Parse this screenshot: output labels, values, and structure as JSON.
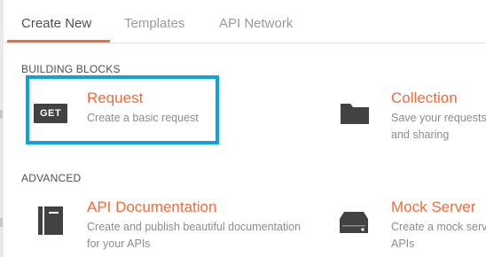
{
  "tabs": [
    {
      "label": "Create New"
    },
    {
      "label": "Templates"
    },
    {
      "label": "API Network"
    }
  ],
  "sections": {
    "building_blocks": "BUILDING BLOCKS",
    "advanced": "ADVANCED"
  },
  "cards": {
    "request": {
      "title": "Request",
      "description": "Create a basic request",
      "icon_text": "GET"
    },
    "collection": {
      "title": "Collection",
      "description_line1": "Save your requests",
      "description_line2": "and sharing"
    },
    "api_documentation": {
      "title": "API Documentation",
      "description_line1": "Create and publish beautiful documentation",
      "description_line2": "for your APIs"
    },
    "mock_server": {
      "title": "Mock Server",
      "description_line1": "Create a mock serv",
      "description_line2": "APIs"
    }
  },
  "colors": {
    "accent": "#f26b3a",
    "highlight": "#0ea3dd",
    "icon": "#424242"
  }
}
